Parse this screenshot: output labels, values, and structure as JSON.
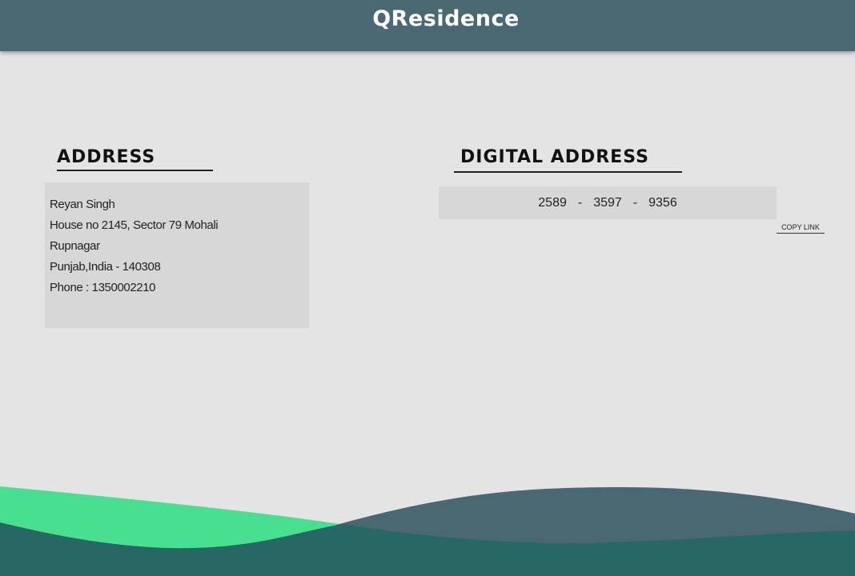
{
  "header": {
    "brand": "QResidence"
  },
  "address": {
    "title": "ADDRESS",
    "lines": [
      "Reyan Singh",
      "House no 2145, Sector 79 Mohali",
      "Rupnagar",
      "Punjab,India - 140308",
      "Phone : 1350002210"
    ]
  },
  "digital_address": {
    "title": "DIGITAL ADDRESS",
    "parts": [
      "2589",
      "3597",
      "9356"
    ],
    "separator": "-",
    "copy_label": "COPY LINK"
  },
  "colors": {
    "header": "#4a6872",
    "background": "#e4e4e4",
    "card": "#d7d7d7",
    "wave_green": "#48e090",
    "wave_slate": "#4a6872",
    "wave_teal": "#276864"
  }
}
